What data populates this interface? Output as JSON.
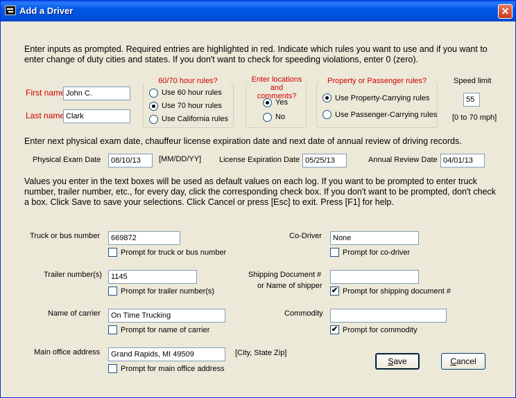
{
  "window": {
    "title": "Add a Driver",
    "close_glyph": "✕"
  },
  "intro": "Enter inputs as prompted.  Required entries are highlighted in red.  Indicate which rules you want to use and if you want to enter change of duty cities and states.  If you don't want to check for speeding violations, enter 0 (zero).",
  "name": {
    "first_label": "First name",
    "first_value": "John C.",
    "last_label": "Last name",
    "last_value": "Clark"
  },
  "hours": {
    "title": "60/70 hour rules?",
    "options": [
      {
        "label": "Use 60 hour rules",
        "checked": false
      },
      {
        "label": "Use 70 hour rules",
        "checked": true
      },
      {
        "label": "Use California rules",
        "checked": false
      }
    ]
  },
  "locations": {
    "title_line1": "Enter locations",
    "title_line2": "and comments?",
    "options": [
      {
        "label": "Yes",
        "checked": true
      },
      {
        "label": "No",
        "checked": false
      }
    ]
  },
  "property": {
    "title": "Property or Passenger rules?",
    "options": [
      {
        "label": "Use Property-Carrying rules",
        "checked": true
      },
      {
        "label": "Use Passenger-Carrying rules",
        "checked": false
      }
    ]
  },
  "speed": {
    "label": "Speed limit",
    "value": "55",
    "range": "[0 to 70 mph]"
  },
  "dates_intro": "Enter next physical exam date, chauffeur license expiration date and next date of annual review of driving records.",
  "dates": {
    "physical_label": "Physical Exam Date",
    "physical_value": "08/10/13",
    "format_hint": "[MM/DD/YY]",
    "license_label": "License Expiration Date",
    "license_value": "05/25/13",
    "review_label": "Annual Review Date",
    "review_value": "04/01/13"
  },
  "defaults_intro": "Values you enter in the text boxes will be used as default values on each log.  If you want to be prompted to enter truck number, trailer number, etc., for every day, click the corresponding check box.  If you don't want to be prompted, don't check a box.  Click Save to save your selections.  Click Cancel or press [Esc] to exit.  Press [F1] for help.",
  "fields": {
    "truck": {
      "label": "Truck or bus number",
      "value": "669872",
      "prompt": "Prompt for truck or bus number",
      "checked": false
    },
    "trailer": {
      "label": "Trailer number(s)",
      "value": "1145",
      "prompt": "Prompt for trailer number(s)",
      "checked": false
    },
    "carrier": {
      "label": "Name of carrier",
      "value": "On Time Trucking",
      "prompt": "Prompt for name of carrier",
      "checked": false
    },
    "office": {
      "label": "Main office address",
      "value": "Grand Rapids, MI  49509",
      "hint": "[City, State Zip]",
      "prompt": "Prompt for main office address",
      "checked": false
    },
    "codriver": {
      "label": "Co-Driver",
      "value": "None",
      "prompt": "Prompt for co-driver",
      "checked": false
    },
    "shipping": {
      "label_line1": "Shipping Document #",
      "label_line2": "or Name of shipper",
      "value": "",
      "prompt": "Prompt for shipping document #",
      "checked": true
    },
    "commodity": {
      "label": "Commodity",
      "value": "",
      "prompt": "Prompt for commodity",
      "checked": true
    }
  },
  "buttons": {
    "save_prefix": "",
    "save_underline": "S",
    "save_rest": "ave",
    "cancel_prefix": "",
    "cancel_underline": "C",
    "cancel_rest": "ancel"
  },
  "checkmark": "✔"
}
